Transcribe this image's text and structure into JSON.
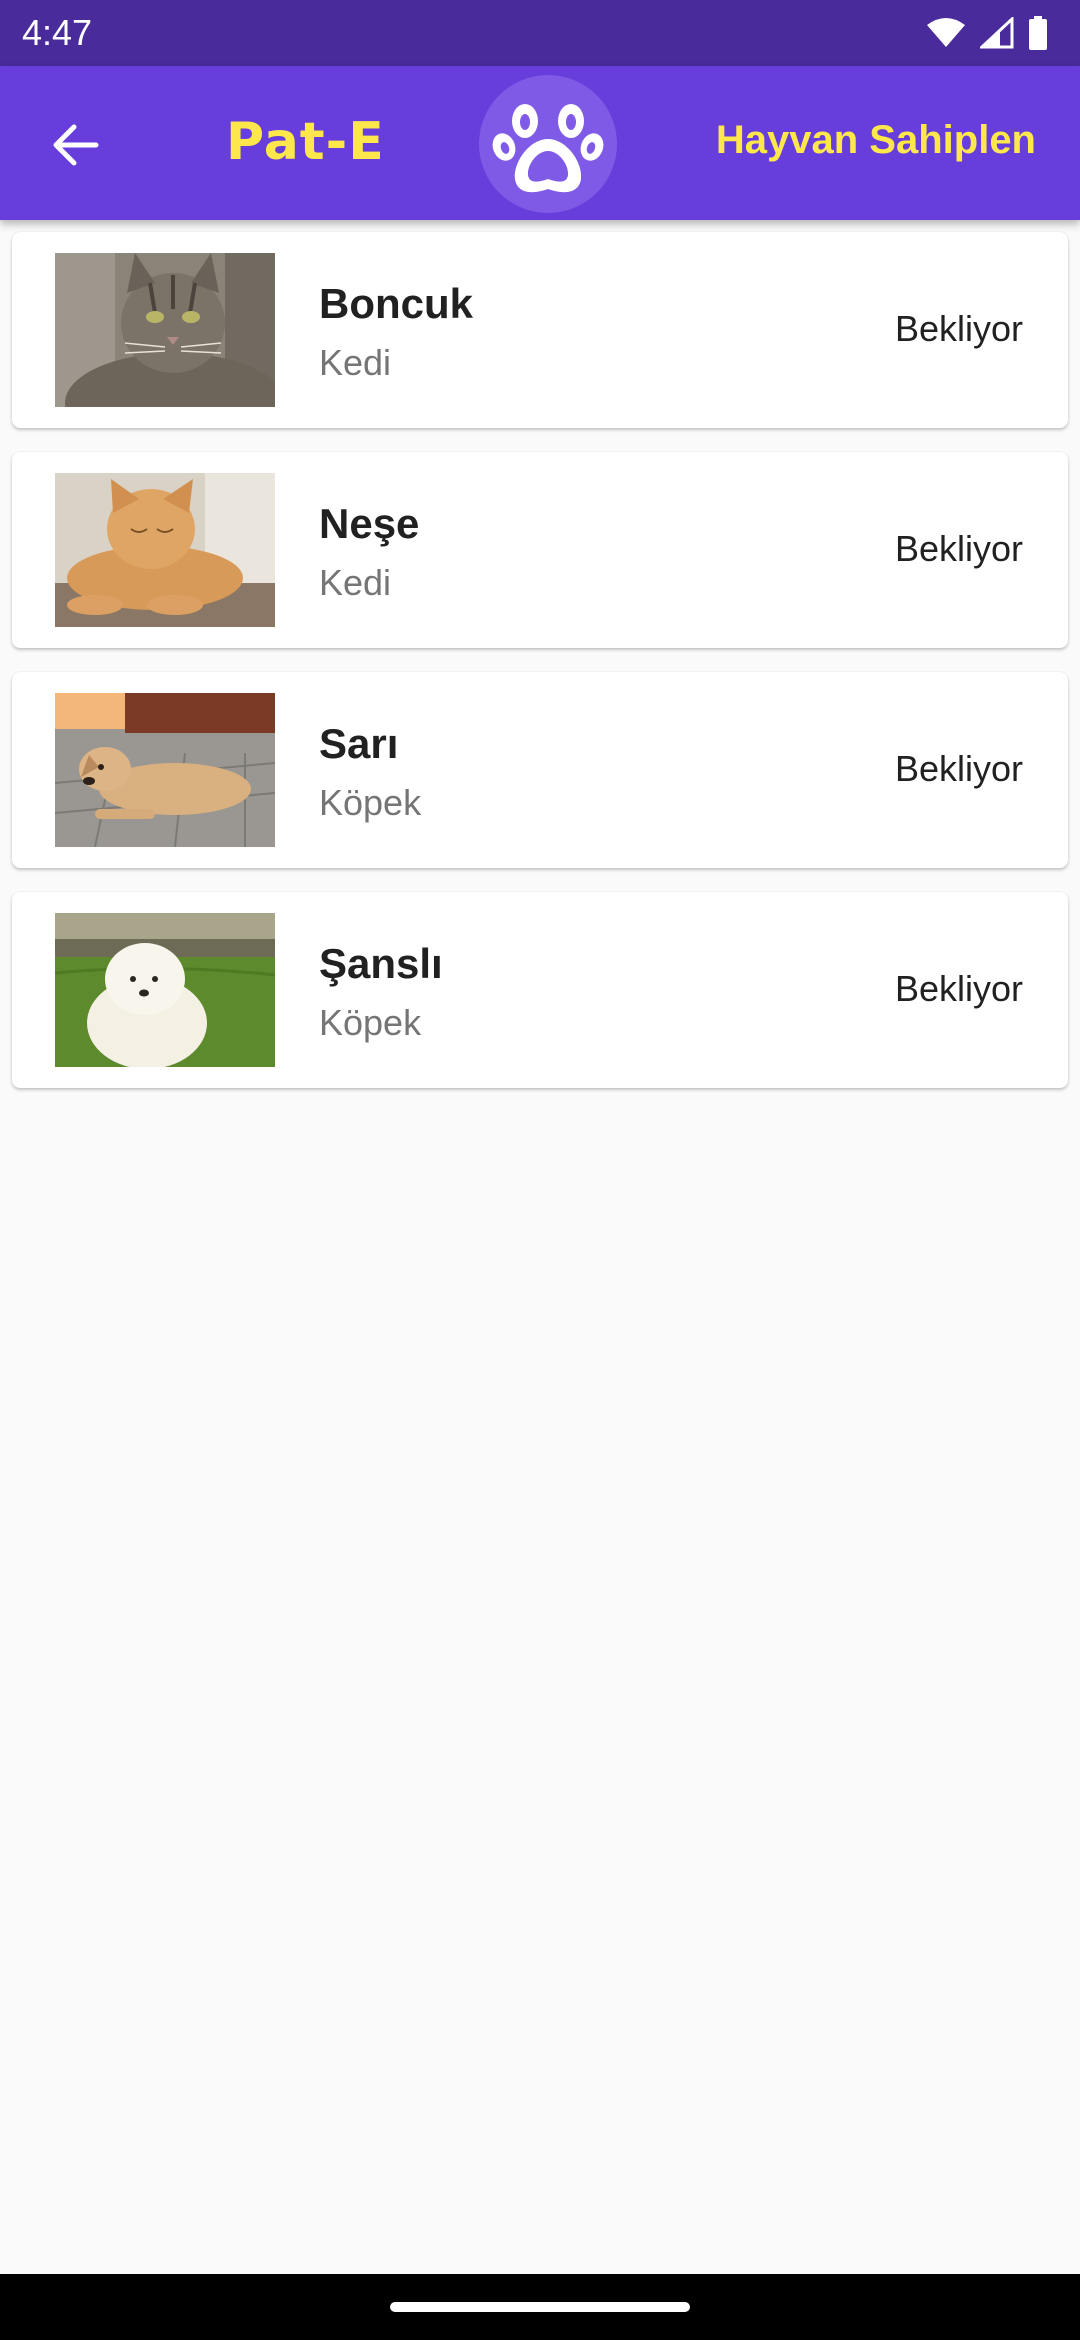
{
  "status_bar": {
    "time": "4:47",
    "icons": [
      "wifi-icon",
      "cellular-signal-icon",
      "battery-icon"
    ]
  },
  "app_bar": {
    "brand": "Pat-E",
    "title": "Hayvan Sahiplen",
    "back_icon": "arrow-left-icon",
    "logo_icon": "paw-icon",
    "colors": {
      "background": "#673ddb",
      "accent_text": "#fde74a",
      "logo_circle": "#7f5ae6"
    }
  },
  "pets": [
    {
      "name": "Boncuk",
      "type": "Kedi",
      "status": "Bekliyor",
      "image": "gray-tabby-cat-photo"
    },
    {
      "name": "Neşe",
      "type": "Kedi",
      "status": "Bekliyor",
      "image": "orange-cat-photo"
    },
    {
      "name": "Sarı",
      "type": "Köpek",
      "status": "Bekliyor",
      "image": "yellow-dog-photo"
    },
    {
      "name": "Şanslı",
      "type": "Köpek",
      "status": "Bekliyor",
      "image": "white-puppy-photo"
    }
  ]
}
